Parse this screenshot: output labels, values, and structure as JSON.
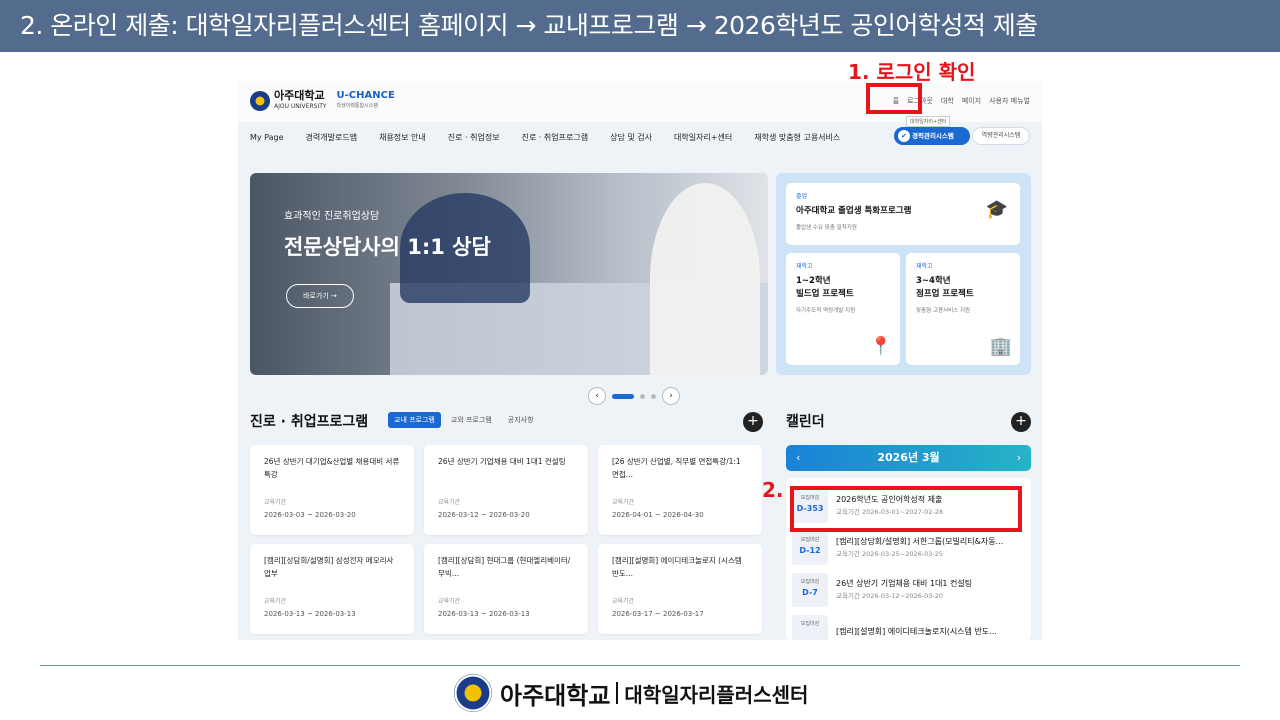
{
  "slide_title": "2. 온라인 제출: 대학일자리플러스센터 홈페이지 → 교내프로그램 → 2026학년도 공인어학성적 제출",
  "annotations": {
    "step1": "1. 로그인 확인",
    "step2": "2."
  },
  "site": {
    "logo": "아주대학교",
    "logo_sub": "AJOU UNIVERSITY",
    "uchance": "U-CHANCE",
    "uchance_sub": "학생이력통합시스템",
    "util_nav": [
      "홈",
      "로그아웃",
      "대학",
      "페이지",
      "사용자 메뉴얼"
    ],
    "util_tooltip": "대학일자리+센터",
    "main_nav": [
      "My Page",
      "경력개발로드맵",
      "채용정보 안내",
      "진로 · 취업정보",
      "진로 · 취업프로그램",
      "상담 및 검사",
      "대학일자리+센터",
      "재학생 맞춤형 고용서비스"
    ],
    "pill_blue": "경력관리시스템",
    "pill_white": "역량관리시스템"
  },
  "hero": {
    "subtitle": "효과적인 진로취업상담",
    "title": "전문상담사의 1:1 상담",
    "button": "바로가기 →"
  },
  "side_cards": [
    {
      "tag": "졸업",
      "title": "아주대학교 졸업생 특화프로그램",
      "desc": "졸업생 수요 맞춤 밀착지원"
    },
    {
      "tag": "재학고",
      "title": "1~2학년\n빌드업 프로젝트",
      "desc": "자기주도적 역량개발 지원"
    },
    {
      "tag": "재학고",
      "title": "3~4학년\n점프업 프로젝트",
      "desc": "맞춤형 고용서비스 지원"
    }
  ],
  "programs": {
    "title": "진로 · 취업프로그램",
    "tabs": [
      "교내 프로그램",
      "교외 프로그램",
      "공지사항"
    ],
    "period_label": "교육기간",
    "items": [
      {
        "title": "26년 상반기 대기업&산업별 채용대비 서류 특강",
        "date": "2026-03-03 ~ 2026-03-20"
      },
      {
        "title": "26년 상반기 기업채용 대비 1대1 컨설팅",
        "date": "2026-03-12 ~ 2026-03-20"
      },
      {
        "title": "[26 상반기 산업별, 직무별 면접특강/1:1 면접...",
        "date": "2026-04-01 ~ 2026-04-30"
      },
      {
        "title": "[캠리][상담회/설명회] 삼성전자 메모리사업부",
        "date": "2026-03-13 ~ 2026-03-13"
      },
      {
        "title": "[캠리][상담회] 현대그룹 (현대엘리베이터/무빅...",
        "date": "2026-03-13 ~ 2026-03-13"
      },
      {
        "title": "[캠리][설명회] 에이디테크놀로지 (시스템 반도...",
        "date": "2026-03-17 ~ 2026-03-17"
      }
    ]
  },
  "calendar": {
    "title": "캘린더",
    "month": "2026년 3월",
    "prev": "‹",
    "next": "›",
    "items": [
      {
        "label": "모집마감",
        "dday": "D-353",
        "title": "2026학년도 공인어학성적 제출",
        "period": "교육기간  2026-03-01~2027-02-28"
      },
      {
        "label": "모집마감",
        "dday": "D-12",
        "title": "[캠리][상담회/설명회] 서한그룹(모빌리티&자동...",
        "period": "교육기간  2026-03-25~2026-03-25"
      },
      {
        "label": "모집마감",
        "dday": "D-7",
        "title": "26년 상반기 기업채용 대비 1대1 컨설팅",
        "period": "교육기간  2026-03-12~2026-03-20"
      },
      {
        "label": "모집마감",
        "dday": "",
        "title": "[캠리][설명회] 에이디테크놀로지(시스템 반도...",
        "period": ""
      }
    ]
  },
  "footer": {
    "name": "아주대학교",
    "sub": "대학일자리플러스센터"
  },
  "colors": {
    "title_bar": "#536b8c",
    "highlight": "#e8141b",
    "accent": "#1a68d1"
  }
}
